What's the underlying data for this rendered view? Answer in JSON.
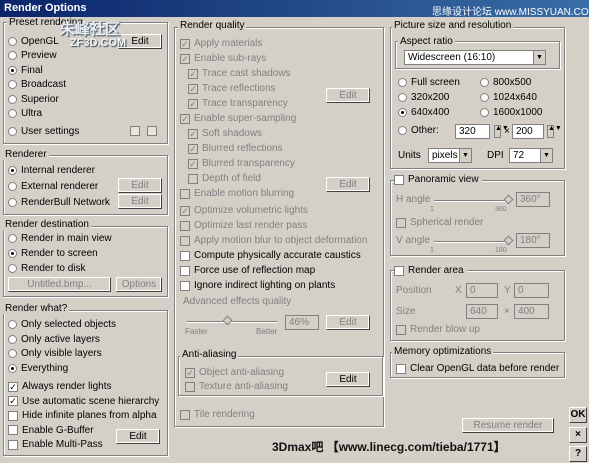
{
  "window": {
    "title": "Render Options"
  },
  "watermarks": {
    "w1": "朱峰社区",
    "w2": "ZF3D.COM",
    "w3": "思缘设计论坛 www.MISSYUAN.COM",
    "w4": "3Dmax吧 【www.linecg.com/tieba/1771】"
  },
  "preset": {
    "title": "Preset rendering",
    "items": [
      "OpenGL",
      "Preview",
      "Final",
      "Broadcast",
      "Superior",
      "Ultra",
      "User settings"
    ],
    "selected": "Final",
    "edit": "Edit"
  },
  "renderer": {
    "title": "Renderer",
    "items": [
      "Internal renderer",
      "External renderer",
      "RenderBull Network"
    ],
    "selected": "Internal renderer",
    "edit1": "Edit",
    "edit2": "Edit"
  },
  "destination": {
    "title": "Render destination",
    "items": [
      "Render in main view",
      "Render to screen",
      "Render to disk"
    ],
    "selected": "Render to screen",
    "file": "Untitled.bmp...",
    "options": "Options"
  },
  "what": {
    "title": "Render what?",
    "items": [
      "Only selected objects",
      "Only active layers",
      "Only visible layers",
      "Everything"
    ],
    "selected": "Everything",
    "checks": [
      {
        "label": "Always render lights",
        "checked": true
      },
      {
        "label": "Use automatic scene hierarchy",
        "checked": true
      },
      {
        "label": "Hide infinite planes from alpha",
        "checked": false
      },
      {
        "label": "Enable G-Buffer",
        "checked": false
      },
      {
        "label": "Enable Multi-Pass",
        "checked": false
      }
    ],
    "edit": "Edit"
  },
  "quality": {
    "title": "Render quality",
    "items": [
      {
        "label": "Apply materials",
        "checked": true,
        "enabled": false
      },
      {
        "label": "Enable sub-rays",
        "checked": true,
        "enabled": false
      },
      {
        "label": "Trace cast shadows",
        "checked": true,
        "enabled": false
      },
      {
        "label": "Trace reflections",
        "checked": true,
        "enabled": false
      },
      {
        "label": "Trace transparency",
        "checked": true,
        "enabled": false
      },
      {
        "label": "Enable super-sampling",
        "checked": true,
        "enabled": false
      },
      {
        "label": "Soft shadows",
        "checked": true,
        "enabled": false
      },
      {
        "label": "Blurred reflections",
        "checked": true,
        "enabled": false
      },
      {
        "label": "Blurred transparency",
        "checked": true,
        "enabled": false
      },
      {
        "label": "Depth of field",
        "checked": false,
        "enabled": false
      },
      {
        "label": "Enable motion blurring",
        "checked": false,
        "enabled": false
      },
      {
        "label": "Optimize volumetric lights",
        "checked": true,
        "enabled": false
      },
      {
        "label": "Optimize last render pass",
        "checked": false,
        "enabled": false
      },
      {
        "label": "Apply motion blur to object deformation",
        "checked": false,
        "enabled": false
      },
      {
        "label": "Compute physically accurate caustics",
        "checked": false,
        "enabled": true
      },
      {
        "label": "Force use of reflection map",
        "checked": false,
        "enabled": true
      },
      {
        "label": "Ignore indirect lighting on plants",
        "checked": false,
        "enabled": true
      }
    ],
    "edit1": "Edit",
    "edit2": "Edit",
    "advanced": "Advanced effects quality",
    "faster": "Faster",
    "better": "Better",
    "percent": "46%",
    "edit3": "Edit",
    "advanced_level": 0.46
  },
  "aa": {
    "title": "Anti-aliasing",
    "items": [
      "Object anti-aliasing",
      "Texture anti-aliasing"
    ],
    "edit": "Edit",
    "tile": "Tile rendering"
  },
  "picture": {
    "title": "Picture size and resolution",
    "aspect_title": "Aspect ratio",
    "aspect": "Widescreen (16:10)",
    "sizes": [
      "Full screen",
      "800x500",
      "320x200",
      "1024x640",
      "640x400",
      "1600x1000"
    ],
    "selected": "640x400",
    "other": "Other:",
    "w": "320",
    "x": "×",
    "h": "200",
    "units_label": "Units",
    "units": "pixels",
    "dpi_label": "DPI",
    "dpi": "72"
  },
  "panoramic": {
    "title": "Panoramic view",
    "h_angle": "H angle",
    "h_val": "360°",
    "h_min": "1",
    "h_max": "360",
    "spherical": "Spherical render",
    "v_angle": "V angle",
    "v_val": "180°",
    "v_min": "1",
    "v_max": "180"
  },
  "area": {
    "title": "Render area",
    "position": "Position",
    "x": "X",
    "xv": "0",
    "y": "Y",
    "yv": "0",
    "size": "Size",
    "sw": "640",
    "sx": "×",
    "sh": "400",
    "blow": "Render blow up"
  },
  "memory": {
    "title": "Memory optimizations",
    "clear": "Clear OpenGL data before render"
  },
  "resume": "Resume render",
  "side": {
    "ok": "OK",
    "close": "×",
    "help": "?"
  }
}
